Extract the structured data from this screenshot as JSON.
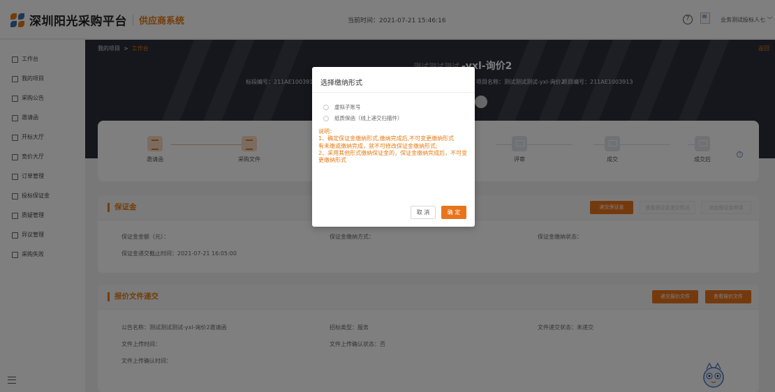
{
  "app": {
    "title": "深圳阳光采购平台",
    "subtitle": "供应商系统",
    "current_time": "当前时间：2021-07-21 15:46:16",
    "username": "业务测试投标人七",
    "accent": "#e8741c"
  },
  "sidebar": {
    "items": [
      {
        "label": "工作台",
        "icon": "workbench-icon"
      },
      {
        "label": "我的项目",
        "icon": "project-icon"
      },
      {
        "label": "采购公告",
        "icon": "announcement-icon"
      },
      {
        "label": "邀请函",
        "icon": "invitation-icon"
      },
      {
        "label": "开标大厅",
        "icon": "bid-hall-icon"
      },
      {
        "label": "竞价大厅",
        "icon": "auction-hall-icon"
      },
      {
        "label": "订单管理",
        "icon": "order-icon"
      },
      {
        "label": "投标保证金",
        "icon": "deposit-icon"
      },
      {
        "label": "质疑管理",
        "icon": "question-icon"
      },
      {
        "label": "异议管理",
        "icon": "objection-icon"
      },
      {
        "label": "采购失败",
        "icon": "failure-icon"
      }
    ]
  },
  "breadcrumb": {
    "root": "我的项目",
    "sep": ">",
    "current": "工作台"
  },
  "back_label": "返回",
  "project": {
    "title_prefix": "测试测试测试",
    "title_main": "-yxl-询价2",
    "bid_no": "标段编号：211AE100391",
    "name": "项目名称：测试测试测试-yxl-询价2",
    "project_no": "项目编号：211AE1003913"
  },
  "steps": [
    {
      "label": "邀请函",
      "state": "done"
    },
    {
      "label": "采购文件",
      "state": "done"
    },
    {
      "label": "评审",
      "state": "todo"
    },
    {
      "label": "成交",
      "state": "todo"
    },
    {
      "label": "成交后",
      "state": "todo"
    }
  ],
  "deposit": {
    "title": "保证金",
    "buttons": [
      "递交保证金",
      "查看保证金递交情况",
      "追加保证金申请"
    ],
    "amount_label": "保证金金额（元）：",
    "method_label": "保证金缴纳方式：",
    "status_label": "保证金缴纳状态：",
    "deadline_label": "保证金递交截止时间：",
    "deadline": "2021-07-21 16:05:00"
  },
  "quote": {
    "title": "报价文件递交",
    "buttons": [
      "递交报价文件",
      "查看报价文件"
    ],
    "notice_label": "公告名称：",
    "notice_value": "测试测试测试-yxl-询价2邀请函",
    "type_label": "招标类型：",
    "type_value": "服务",
    "submit_status_label": "文件递交状态：",
    "submit_status_value": "未递交",
    "upload_time_label": "文件上传时间：",
    "confirm_status_label": "文件上传确认状态：",
    "confirm_status_value": "否",
    "confirm_time_label": "文件上传确认时间："
  },
  "modal": {
    "title": "选择缴纳形式",
    "options": [
      "虚拟子账号",
      "纸质保函（线上递交扫描件）"
    ],
    "notes": [
      "说明：",
      "1、确定保证金缴纳形式,缴纳完成后,不可变更缴纳形式",
      "有未缴或缴纳完成，就不可修改保证金缴纳形式;",
      "2、采用其他形式缴纳保证金的，保证金缴纳完成后，不可变更缴纳形式"
    ],
    "cancel": "取 消",
    "confirm": "确 定"
  }
}
